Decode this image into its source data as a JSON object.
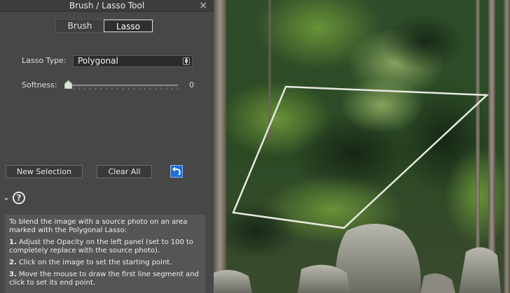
{
  "window": {
    "title": "Brush / Lasso Tool",
    "close_glyph": "×"
  },
  "tabs": [
    {
      "label": "Brush",
      "active": false
    },
    {
      "label": "Lasso",
      "active": true
    }
  ],
  "lasso_type": {
    "label": "Lasso Type:",
    "value": "Polygonal"
  },
  "softness": {
    "label": "Softness:",
    "value": "0",
    "level": 0
  },
  "buttons": {
    "new_selection": "New Selection",
    "clear_all": "Clear All",
    "undo_icon": "undo-icon"
  },
  "help": {
    "intro": "To blend the image with a source photo on an area marked with the Polygonal Lasso:",
    "steps": [
      {
        "num": "1.",
        "text": "Adjust the Opacity on the left panel (set to 100 to completely replace with the source photo)."
      },
      {
        "num": "2.",
        "text": "Click on the image to set the starting point."
      },
      {
        "num": "3.",
        "text": "Move the mouse to draw the first line segment and click to set its end point."
      }
    ]
  },
  "colors": {
    "panel_bg": "#474747",
    "accent_blue": "#1e6fd8",
    "selection_stroke": "#e8e8e0"
  }
}
